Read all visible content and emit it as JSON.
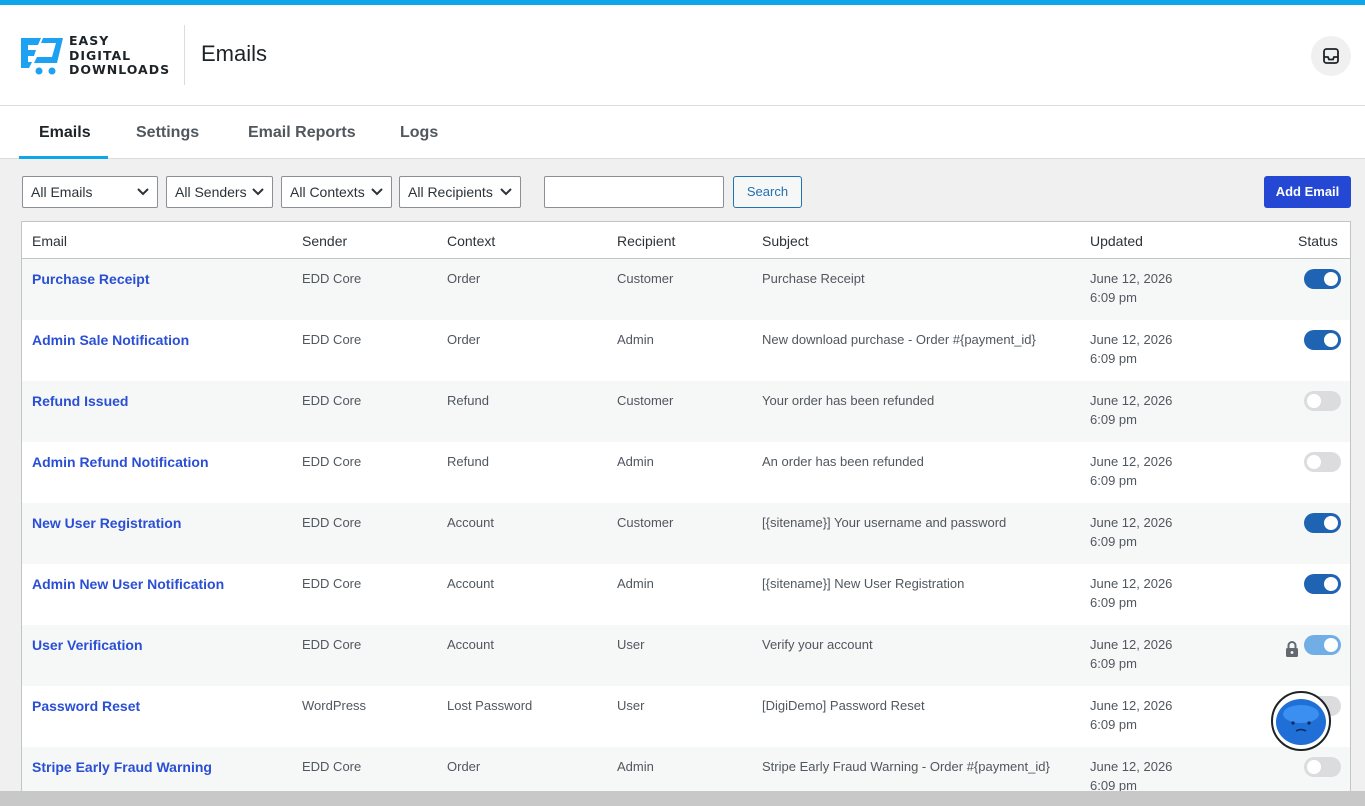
{
  "header": {
    "brand_line1": "EASY",
    "brand_line2": "DIGITAL",
    "brand_line3": "DOWNLOADS",
    "page_title": "Emails"
  },
  "tabs": [
    {
      "label": "Emails",
      "active": true
    },
    {
      "label": "Settings",
      "active": false
    },
    {
      "label": "Email Reports",
      "active": false
    },
    {
      "label": "Logs",
      "active": false
    }
  ],
  "filters": {
    "emails": "All Emails",
    "senders": "All Senders",
    "contexts": "All Contexts",
    "recipients": "All Recipients",
    "search_value": "",
    "search_label": "Search",
    "add_label": "Add Email"
  },
  "table": {
    "columns": [
      "Email",
      "Sender",
      "Context",
      "Recipient",
      "Subject",
      "Updated",
      "Status"
    ],
    "rows": [
      {
        "email": "Purchase Receipt",
        "sender": "EDD Core",
        "context": "Order",
        "recipient": "Customer",
        "subject": "Purchase Receipt",
        "date": "June 12, 2026",
        "time": "6:09 pm",
        "status": "on"
      },
      {
        "email": "Admin Sale Notification",
        "sender": "EDD Core",
        "context": "Order",
        "recipient": "Admin",
        "subject": "New download purchase - Order #{payment_id}",
        "date": "June 12, 2026",
        "time": "6:09 pm",
        "status": "on"
      },
      {
        "email": "Refund Issued",
        "sender": "EDD Core",
        "context": "Refund",
        "recipient": "Customer",
        "subject": "Your order has been refunded",
        "date": "June 12, 2026",
        "time": "6:09 pm",
        "status": "off"
      },
      {
        "email": "Admin Refund Notification",
        "sender": "EDD Core",
        "context": "Refund",
        "recipient": "Admin",
        "subject": "An order has been refunded",
        "date": "June 12, 2026",
        "time": "6:09 pm",
        "status": "off"
      },
      {
        "email": "New User Registration",
        "sender": "EDD Core",
        "context": "Account",
        "recipient": "Customer",
        "subject": "[{sitename}] Your username and password",
        "date": "June 12, 2026",
        "time": "6:09 pm",
        "status": "on"
      },
      {
        "email": "Admin New User Notification",
        "sender": "EDD Core",
        "context": "Account",
        "recipient": "Admin",
        "subject": "[{sitename}] New User Registration",
        "date": "June 12, 2026",
        "time": "6:09 pm",
        "status": "on"
      },
      {
        "email": "User Verification",
        "sender": "EDD Core",
        "context": "Account",
        "recipient": "User",
        "subject": "Verify your account",
        "date": "June 12, 2026",
        "time": "6:09 pm",
        "status": "locked"
      },
      {
        "email": "Password Reset",
        "sender": "WordPress",
        "context": "Lost Password",
        "recipient": "User",
        "subject": "[DigiDemo] Password Reset",
        "date": "June 12, 2026",
        "time": "6:09 pm",
        "status": "off"
      },
      {
        "email": "Stripe Early Fraud Warning",
        "sender": "EDD Core",
        "context": "Order",
        "recipient": "Admin",
        "subject": "Stripe Early Fraud Warning - Order #{payment_id}",
        "date": "June 12, 2026",
        "time": "6:09 pm",
        "status": "off"
      }
    ]
  },
  "icons": {
    "inbox": "inbox-icon",
    "chevron": "chevron-down-icon",
    "lock": "lock-icon"
  },
  "colors": {
    "accent": "#0ea5e9",
    "link": "#2a4fd4",
    "toggle_on": "#1f64b2",
    "toggle_off": "#dcdcde",
    "toggle_locked": "#72aee6",
    "primary_button": "#2548d4"
  }
}
